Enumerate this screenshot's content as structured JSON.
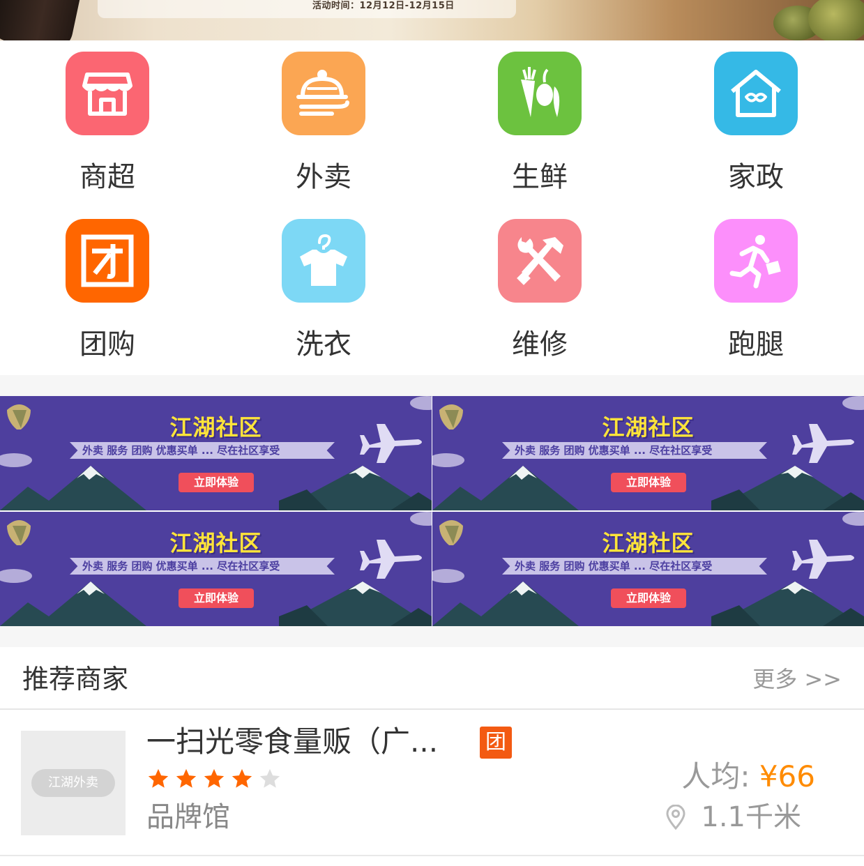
{
  "top_banner": {
    "event_time": "活动时间：12月12日-12月15日"
  },
  "categories": [
    {
      "label": "商超",
      "icon": "store-icon",
      "color": "#fb6672"
    },
    {
      "label": "外卖",
      "icon": "food-cloche-icon",
      "color": "#fba653"
    },
    {
      "label": "生鲜",
      "icon": "vegetables-icon",
      "color": "#6cc23f"
    },
    {
      "label": "家政",
      "icon": "house-icon",
      "color": "#35b9e6"
    },
    {
      "label": "团购",
      "icon": "group-buy-icon",
      "color": "#ff6600"
    },
    {
      "label": "洗衣",
      "icon": "laundry-shirt-icon",
      "color": "#7dd8f5"
    },
    {
      "label": "维修",
      "icon": "repair-tools-icon",
      "color": "#f7858c"
    },
    {
      "label": "跑腿",
      "icon": "courier-runner-icon",
      "color": "#fc8ffb"
    }
  ],
  "ads": [
    {
      "title": "江湖社区",
      "subtitle": "外卖  服务  团购  优惠买单 ... 尽在社区享受",
      "button": "立即体验"
    },
    {
      "title": "江湖社区",
      "subtitle": "外卖  服务  团购  优惠买单 ... 尽在社区享受",
      "button": "立即体验"
    },
    {
      "title": "江湖社区",
      "subtitle": "外卖  服务  团购  优惠买单 ... 尽在社区享受",
      "button": "立即体验"
    },
    {
      "title": "江湖社区",
      "subtitle": "外卖  服务  团购  优惠买单 ... 尽在社区享受",
      "button": "立即体验"
    }
  ],
  "recommended": {
    "title": "推荐商家",
    "more": "更多 >>",
    "stores": [
      {
        "thumb_label": "江湖外卖",
        "name": "一扫光零食量贩（广...",
        "badge": "团",
        "rating": 4,
        "rating_max": 5,
        "tag": "品牌馆",
        "avg_label": "人均:",
        "avg_price": "¥66",
        "distance": "1.1千米"
      }
    ]
  },
  "colors": {
    "accent_orange": "#ff8b00",
    "star_active": "#ff6600",
    "star_inactive": "#dddddd",
    "ad_bg": "#4e3f9e",
    "ad_title": "#ffe43a"
  }
}
